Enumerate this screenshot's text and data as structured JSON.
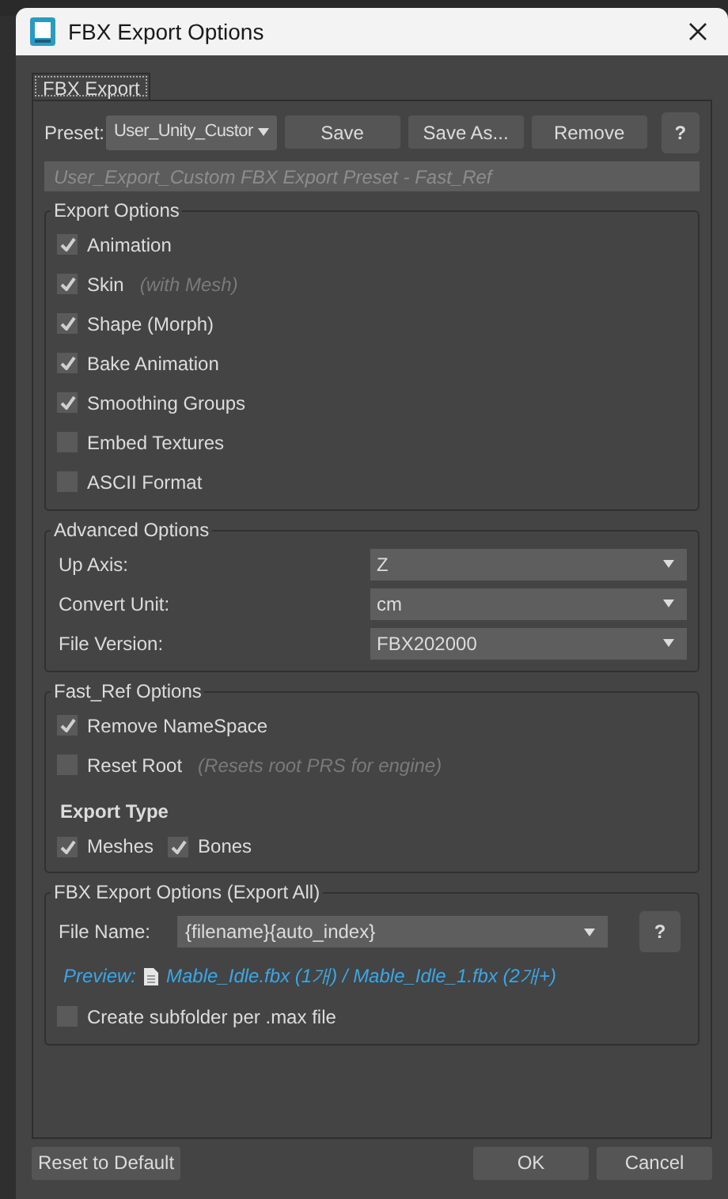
{
  "window": {
    "title": "FBX Export Options"
  },
  "tabs": [
    {
      "label": "FBX Export",
      "selected": true
    }
  ],
  "preset": {
    "label": "Preset:",
    "value": "User_Unity_Custor",
    "buttons": [
      "Save",
      "Save As...",
      "Remove"
    ],
    "help": "?",
    "description": "User_Export_Custom FBX Export Preset - Fast_Ref"
  },
  "groups": [
    {
      "title": "Export Options",
      "rows": [
        {
          "kind": "checkbox",
          "label": "Animation",
          "checked": true
        },
        {
          "kind": "checkbox",
          "label": "Skin",
          "note": "(with Mesh)",
          "checked": true
        },
        {
          "kind": "checkbox",
          "label": "Shape (Morph)",
          "checked": true
        },
        {
          "kind": "checkbox",
          "label": "Bake Animation",
          "checked": true
        },
        {
          "kind": "checkbox",
          "label": "Smoothing Groups",
          "checked": true
        },
        {
          "kind": "checkbox",
          "label": "Embed Textures",
          "checked": false
        },
        {
          "kind": "checkbox",
          "label": "ASCII Format",
          "checked": false
        }
      ]
    },
    {
      "title": "Advanced Options",
      "rows": [
        {
          "kind": "dropdown",
          "label": "Up Axis:",
          "value": "Z"
        },
        {
          "kind": "dropdown",
          "label": "Convert Unit:",
          "value": "cm"
        },
        {
          "kind": "dropdown",
          "label": "File Version:",
          "value": "FBX202000"
        }
      ]
    },
    {
      "title": "Fast_Ref Options",
      "rows": [
        {
          "kind": "checkbox",
          "label": "Remove NameSpace",
          "checked": true
        },
        {
          "kind": "checkbox",
          "label": "Reset Root",
          "note": "(Resets root PRS for engine)",
          "checked": false
        },
        {
          "kind": "heading",
          "label": "Export Type"
        },
        {
          "kind": "checkbox_row",
          "items": [
            {
              "label": "Meshes",
              "checked": true
            },
            {
              "label": "Bones",
              "checked": true
            }
          ]
        }
      ]
    },
    {
      "title": "FBX Export Options (Export All)",
      "rows": [
        {
          "kind": "file_name",
          "label": "File Name:",
          "value": "{filename}{auto_index}",
          "help": "?"
        },
        {
          "kind": "preview",
          "label": "Preview:",
          "text": "Mable_Idle.fbx (1개) / Mable_Idle_1.fbx (2개+)"
        },
        {
          "kind": "checkbox",
          "label": "Create subfolder per .max file",
          "checked": false
        }
      ]
    }
  ],
  "footer": {
    "buttons": [
      "Reset to Default",
      "OK",
      "Cancel"
    ]
  }
}
